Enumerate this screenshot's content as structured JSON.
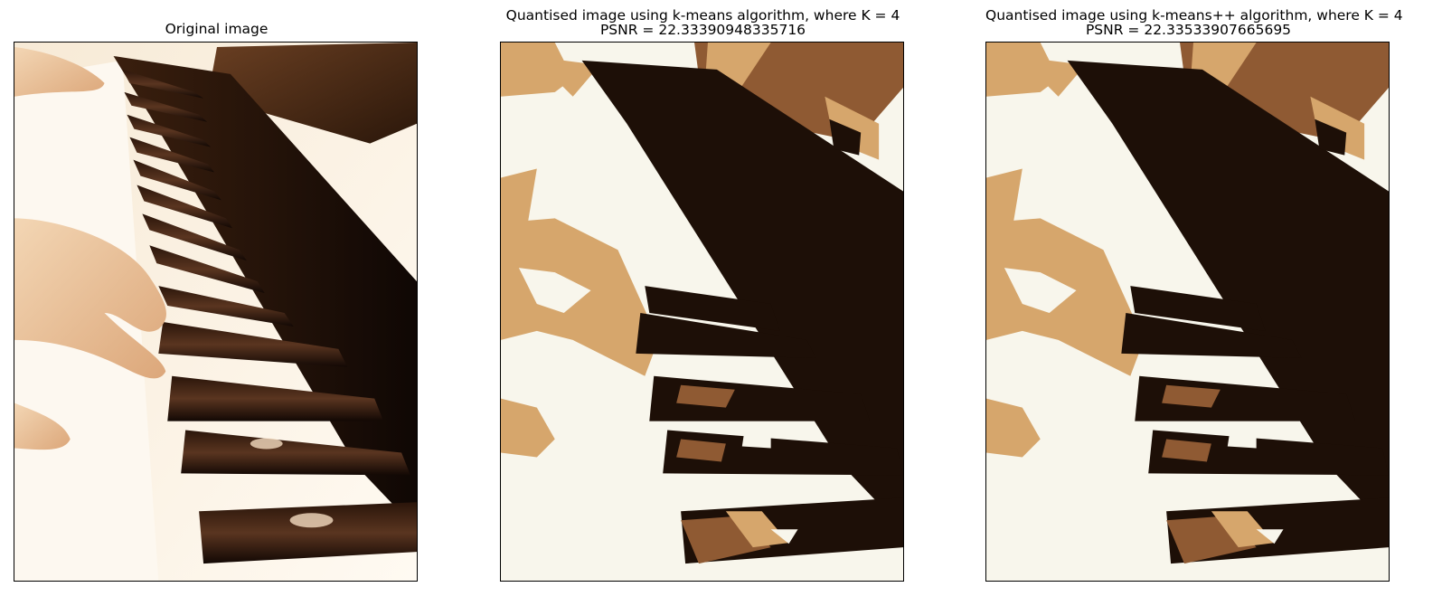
{
  "panels": [
    {
      "title_line1": "Original image",
      "title_line2": "",
      "kind": "original"
    },
    {
      "title_line1": "Quantised image using k-means algorithm, where K = 4",
      "title_line2": "PSNR = 22.33390948335716",
      "kind": "quantised"
    },
    {
      "title_line1": "Quantised image using k-means++ algorithm, where K = 4",
      "title_line2": "PSNR = 22.33533907665695",
      "kind": "quantised"
    }
  ],
  "palette": {
    "cream": "#f8f6ec",
    "tan": "#d6a66c",
    "brown": "#8f5a33",
    "dark": "#1d0f07"
  }
}
